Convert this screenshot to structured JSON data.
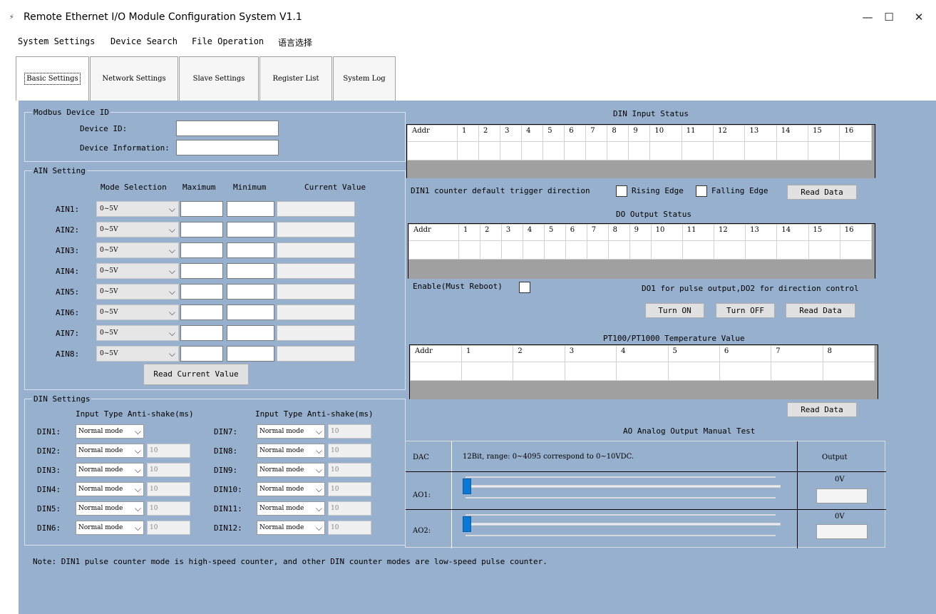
{
  "window": {
    "title": "Remote Ethernet I/O Module Configuration System V1.1",
    "app_icon": "⚡",
    "minimize": "—",
    "maximize": "☐",
    "close": "✕"
  },
  "menu": [
    "System Settings",
    "Device Search",
    "File Operation",
    "语言选择"
  ],
  "tabs": [
    "Basic Settings",
    "Network Settings",
    "Slave Settings",
    "Register List",
    "System Log"
  ],
  "modbus": {
    "title": "Modbus Device ID",
    "device_id_label": "Device ID:",
    "device_info_label": "Device Information:",
    "device_id": "",
    "device_info": ""
  },
  "ain": {
    "title": "AIN Setting",
    "headers": [
      "Mode Selection",
      "Maximum",
      "Minimum",
      "Current Value"
    ],
    "rows": [
      {
        "label": "AIN1:",
        "mode": "0~5V"
      },
      {
        "label": "AIN2:",
        "mode": "0~5V"
      },
      {
        "label": "AIN3:",
        "mode": "0~5V"
      },
      {
        "label": "AIN4:",
        "mode": "0~5V"
      },
      {
        "label": "AIN5:",
        "mode": "0~5V"
      },
      {
        "label": "AIN6:",
        "mode": "0~5V"
      },
      {
        "label": "AIN7:",
        "mode": "0~5V"
      },
      {
        "label": "AIN8:",
        "mode": "0~5V"
      }
    ],
    "read_button": "Read Current Value"
  },
  "din": {
    "title": "DIN Settings",
    "header": "Input Type Anti-shake(ms)",
    "left": [
      {
        "label": "DIN1:",
        "mode": "Normal mode",
        "value": null
      },
      {
        "label": "DIN2:",
        "mode": "Normal mode",
        "value": "10"
      },
      {
        "label": "DIN3:",
        "mode": "Normal mode",
        "value": "10"
      },
      {
        "label": "DIN4:",
        "mode": "Normal mode",
        "value": "10"
      },
      {
        "label": "DIN5:",
        "mode": "Normal mode",
        "value": "10"
      },
      {
        "label": "DIN6:",
        "mode": "Normal mode",
        "value": "10"
      }
    ],
    "right": [
      {
        "label": "DIN7:",
        "mode": "Normal mode",
        "value": "10"
      },
      {
        "label": "DIN8:",
        "mode": "Normal mode",
        "value": "10"
      },
      {
        "label": "DIN9:",
        "mode": "Normal mode",
        "value": "10"
      },
      {
        "label": "DIN10:",
        "mode": "Normal mode",
        "value": "10"
      },
      {
        "label": "DIN11:",
        "mode": "Normal mode",
        "value": "10"
      },
      {
        "label": "DIN12:",
        "mode": "Normal mode",
        "value": "10"
      }
    ]
  },
  "din_status": {
    "title": "DIN Input Status",
    "columns": [
      "Addr",
      "1",
      "2",
      "3",
      "4",
      "5",
      "6",
      "7",
      "8",
      "9",
      "10",
      "11",
      "12",
      "13",
      "14",
      "15",
      "16"
    ]
  },
  "din_counter": {
    "label": "DIN1 counter default trigger direction",
    "rising": "Rising Edge",
    "falling": "Falling Edge",
    "read": "Read Data"
  },
  "do_status": {
    "title": "DO Output Status",
    "columns": [
      "Addr",
      "1",
      "2",
      "3",
      "4",
      "5",
      "6",
      "7",
      "8",
      "9",
      "10",
      "11",
      "12",
      "13",
      "14",
      "15",
      "16"
    ]
  },
  "do_ctrl": {
    "enable_label": "Enable(Must Reboot)",
    "note": "DO1 for pulse output,DO2 for direction control",
    "turn_on": "Turn ON",
    "turn_off": "Turn OFF",
    "read": "Read Data"
  },
  "pt": {
    "title": "PT100/PT1000 Temperature Value",
    "columns": [
      "Addr",
      "1",
      "2",
      "3",
      "4",
      "5",
      "6",
      "7",
      "8"
    ],
    "read": "Read Data"
  },
  "ao": {
    "title": "AO Analog Output Manual Test",
    "col1": "DAC",
    "col2": "12Bit, range: 0~4095 correspond to 0~10VDC.",
    "col3": "Output",
    "rows": [
      {
        "label": "AO1:",
        "value": "0V",
        "level": 0
      },
      {
        "label": "AO2:",
        "value": "0V",
        "level": 0
      }
    ]
  },
  "note": "Note: DIN1 pulse counter mode is high-speed counter, and other DIN counter modes are low-speed pulse counter."
}
